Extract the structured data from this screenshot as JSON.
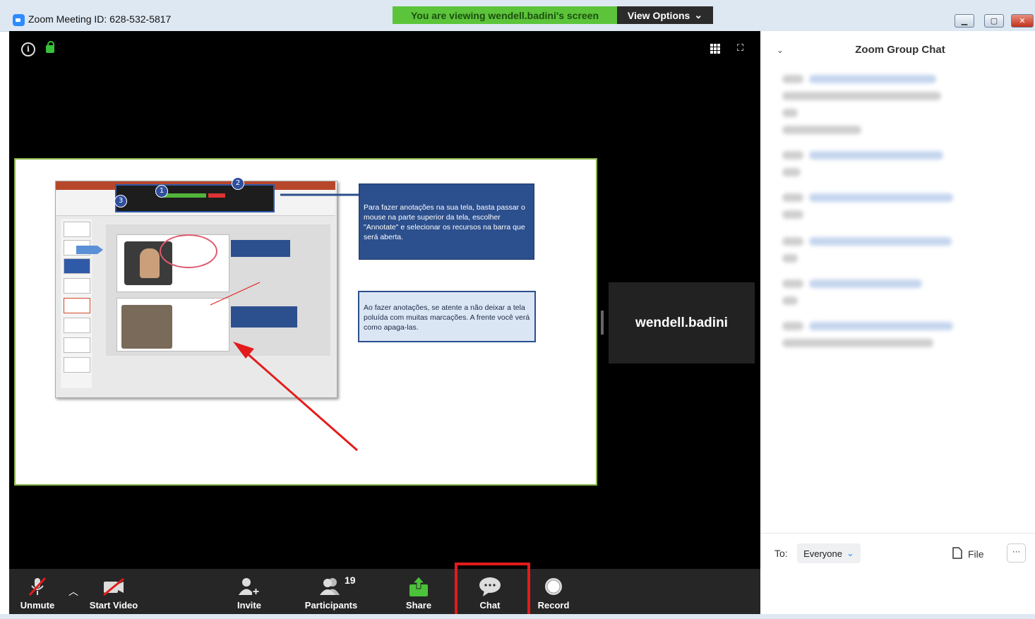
{
  "window": {
    "title": "Zoom Meeting ID: 628-532-5817",
    "viewing_banner": "You are viewing wendell.badini's screen",
    "view_options": "View Options",
    "controls": {
      "minimize": "▁",
      "maximize": "▢",
      "close": "✕"
    }
  },
  "shared_screen": {
    "note_top": "Para fazer anotações na sua tela, basta passar o mouse na parte superior da tela, escolher \"Annotate\" e selecionar os recursos na barra que será aberta.",
    "note_bottom": "Ao fazer anotações, se atente a não deixar a tela poluída com muitas marcações. A frente você verá como apaga-las.",
    "badges": [
      "1",
      "2",
      "3"
    ]
  },
  "presenter": {
    "name": "wendell.badini"
  },
  "toolbar": {
    "unmute": "Unmute",
    "start_video": "Start Video",
    "invite": "Invite",
    "participants": "Participants",
    "participants_count": "19",
    "share": "Share",
    "chat": "Chat",
    "record": "Record"
  },
  "chat": {
    "title": "Zoom Group Chat",
    "to_label": "To:",
    "recipient": "Everyone",
    "file": "File",
    "more": "···"
  },
  "colors": {
    "banner_green": "#5cc43a",
    "highlight_red": "#e41b1b",
    "share_green": "#4cc23b",
    "slide_blue": "#2c4f8d"
  },
  "icons": [
    "info-icon",
    "lock-icon",
    "grid-icon",
    "fullscreen-icon",
    "mic-muted-icon",
    "video-off-icon",
    "invite-icon",
    "participants-icon",
    "share-icon",
    "chat-icon",
    "record-icon",
    "file-icon",
    "chevron-down-icon"
  ]
}
